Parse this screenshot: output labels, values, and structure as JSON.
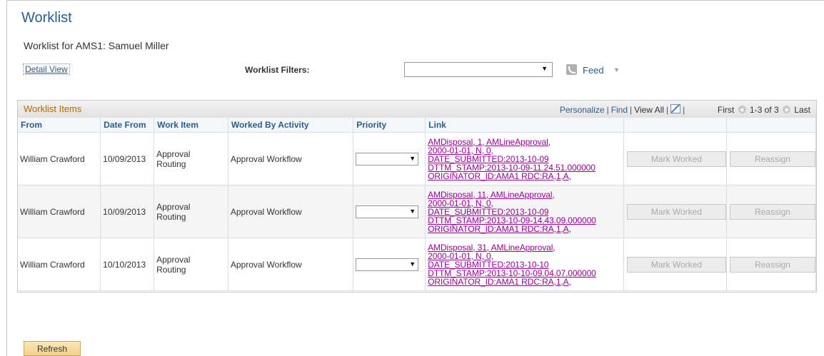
{
  "page": {
    "title": "Worklist",
    "subtitle": "Worklist for AMS1: Samuel Miller"
  },
  "toolbar": {
    "detail_view": "Detail View",
    "filters_label": "Worklist Filters:",
    "filters_value": "",
    "feed_label": "Feed"
  },
  "grid": {
    "title": "Worklist Items",
    "nav": {
      "personalize": "Personalize",
      "find": "Find",
      "view_all": "View All",
      "first": "First",
      "range": "1-3 of 3",
      "last": "Last"
    },
    "columns": [
      "From",
      "Date From",
      "Work Item",
      "Worked By Activity",
      "Priority",
      "Link",
      "",
      ""
    ],
    "rows": [
      {
        "from": "William Crawford",
        "date": "10/09/2013",
        "work_item_1": "Approval",
        "work_item_2": "Routing",
        "activity": "Approval Workflow",
        "priority": "",
        "link": [
          "AMDisposal, 1, AMLineApproval,",
          "2000-01-01, N, 0,",
          "DATE_SUBMITTED:2013-10-09",
          "DTTM_STAMP:2013-10-09-11.24.51.000000",
          "ORIGINATOR_ID:AMA1 RDC:RA,1,A,"
        ],
        "mark_worked": "Mark Worked",
        "reassign": "Reassign"
      },
      {
        "from": "William Crawford",
        "date": "10/09/2013",
        "work_item_1": "Approval",
        "work_item_2": "Routing",
        "activity": "Approval Workflow",
        "priority": "",
        "link": [
          "AMDisposal, 11, AMLineApproval,",
          "2000-01-01, N, 0,",
          "DATE_SUBMITTED:2013-10-09",
          "DTTM_STAMP:2013-10-09-14.43.09.000000",
          "ORIGINATOR_ID:AMA1 RDC:RA,1,A,"
        ],
        "mark_worked": "Mark Worked",
        "reassign": "Reassign"
      },
      {
        "from": "William Crawford",
        "date": "10/10/2013",
        "work_item_1": "Approval",
        "work_item_2": "Routing",
        "activity": "Approval Workflow",
        "priority": "",
        "link": [
          "AMDisposal, 31, AMLineApproval,",
          "2000-01-01, N, 0,",
          "DATE_SUBMITTED:2013-10-10",
          "DTTM_STAMP:2013-10-10-09.04.07.000000",
          "ORIGINATOR_ID:AMA1 RDC:RA,1,A,"
        ],
        "mark_worked": "Mark Worked",
        "reassign": "Reassign"
      }
    ]
  },
  "footer": {
    "refresh": "Refresh"
  },
  "colors": {
    "title": "#2b5e8c",
    "grid_title": "#b06a00",
    "link": "#990099",
    "refresh_bg": "#f2d08a"
  }
}
